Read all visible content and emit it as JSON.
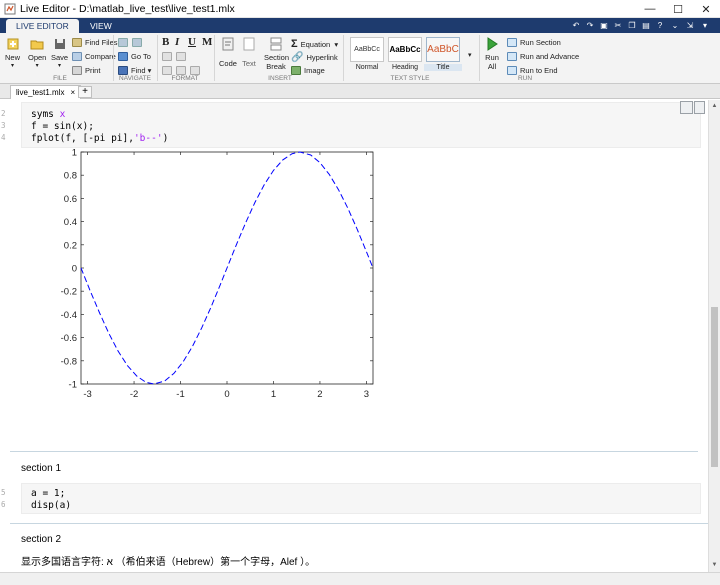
{
  "window": {
    "title": "Live Editor - D:\\matlab_live_test\\live_test1.mlx",
    "minimize": "—",
    "maximize": "☐",
    "close": "✕"
  },
  "ribbon_tabs": [
    "LIVE EDITOR",
    "VIEW"
  ],
  "ribbon": {
    "file": {
      "new": "New",
      "open": "Open",
      "save": "Save",
      "find_files": "Find Files",
      "compare": "Compare",
      "print": "Print",
      "label": "FILE"
    },
    "navigate": {
      "go_to": "Go To",
      "find": "Find",
      "label": "NAVIGATE"
    },
    "format": {
      "bold": "B",
      "italic": "I",
      "underline": "U",
      "mono": "M",
      "label": "FORMAT"
    },
    "insert": {
      "code": "Code",
      "text": "Text",
      "section_break": "Section Break",
      "equation": "Equation",
      "hyperlink": "Hyperlink",
      "image": "Image",
      "label": "INSERT"
    },
    "text_style": {
      "sample": "AaBbCc",
      "title_sample": "AaBbC",
      "normal": "Normal",
      "heading": "Heading",
      "title": "Title",
      "label": "TEXT STYLE"
    },
    "run": {
      "run_all": "Run All",
      "run_section": "Run Section",
      "run_and_advance": "Run and Advance",
      "run_to_end": "Run to End",
      "label": "RUN"
    }
  },
  "doc_tab": {
    "name": "live_test1.mlx",
    "close": "×",
    "add": "+"
  },
  "code1": {
    "lines": [
      {
        "num": "2",
        "code": "syms ",
        "var": "x"
      },
      {
        "num": "3",
        "code": "f = sin(x);"
      },
      {
        "num": "4",
        "code": "fplot(f, [-pi pi],",
        "str": "'b--'",
        "end": ")"
      }
    ]
  },
  "section1": {
    "title": "section 1",
    "lines": [
      {
        "num": "5",
        "code": "a = 1;"
      },
      {
        "num": "6",
        "code": "disp(a)"
      }
    ]
  },
  "section2": {
    "title": "section 2",
    "text": "显示多国语言字符: א （希伯来语（Hebrew）第一个字母，Alef ）。"
  },
  "colors": {
    "line": "#0000ff",
    "ribbon_blue": "#1e3b6e"
  },
  "chart_data": {
    "type": "line",
    "function": "sin(x)",
    "line_style": "dashed",
    "xlim": [
      -3.14159,
      3.14159
    ],
    "ylim": [
      -1,
      1
    ],
    "xticks": [
      -3,
      -2,
      -1,
      0,
      1,
      2,
      3
    ],
    "yticks": [
      -1,
      -0.8,
      -0.6,
      -0.4,
      -0.2,
      0,
      0.2,
      0.4,
      0.6,
      0.8,
      1
    ],
    "xticklabels": [
      "-3",
      "-2",
      "-1",
      "0",
      "1",
      "2",
      "3"
    ],
    "yticklabels": [
      "-1",
      "-0.8",
      "-0.6",
      "-0.4",
      "-0.2",
      "0",
      "0.2",
      "0.4",
      "0.6",
      "0.8",
      "1"
    ],
    "series": [
      {
        "x": [
          -3.1416,
          -2.9416,
          -2.7416,
          -2.5416,
          -2.3416,
          -2.1416,
          -1.9416,
          -1.7416,
          -1.5708,
          -1.3416,
          -1.1416,
          -0.9416,
          -0.7416,
          -0.5416,
          -0.3416,
          -0.1416,
          0,
          0.2,
          0.4,
          0.6,
          0.8,
          1.0,
          1.2,
          1.4,
          1.5708,
          1.8,
          2.0,
          2.2,
          2.4,
          2.6,
          2.8,
          3.0,
          3.1416
        ],
        "y": [
          0,
          -0.199,
          -0.388,
          -0.565,
          -0.718,
          -0.842,
          -0.932,
          -0.986,
          -1,
          -0.974,
          -0.909,
          -0.808,
          -0.675,
          -0.515,
          -0.335,
          -0.141,
          0,
          0.199,
          0.389,
          0.565,
          0.717,
          0.841,
          0.932,
          0.985,
          1,
          0.974,
          0.909,
          0.808,
          0.675,
          0.516,
          0.335,
          0.141,
          0
        ]
      }
    ],
    "grid": false
  }
}
